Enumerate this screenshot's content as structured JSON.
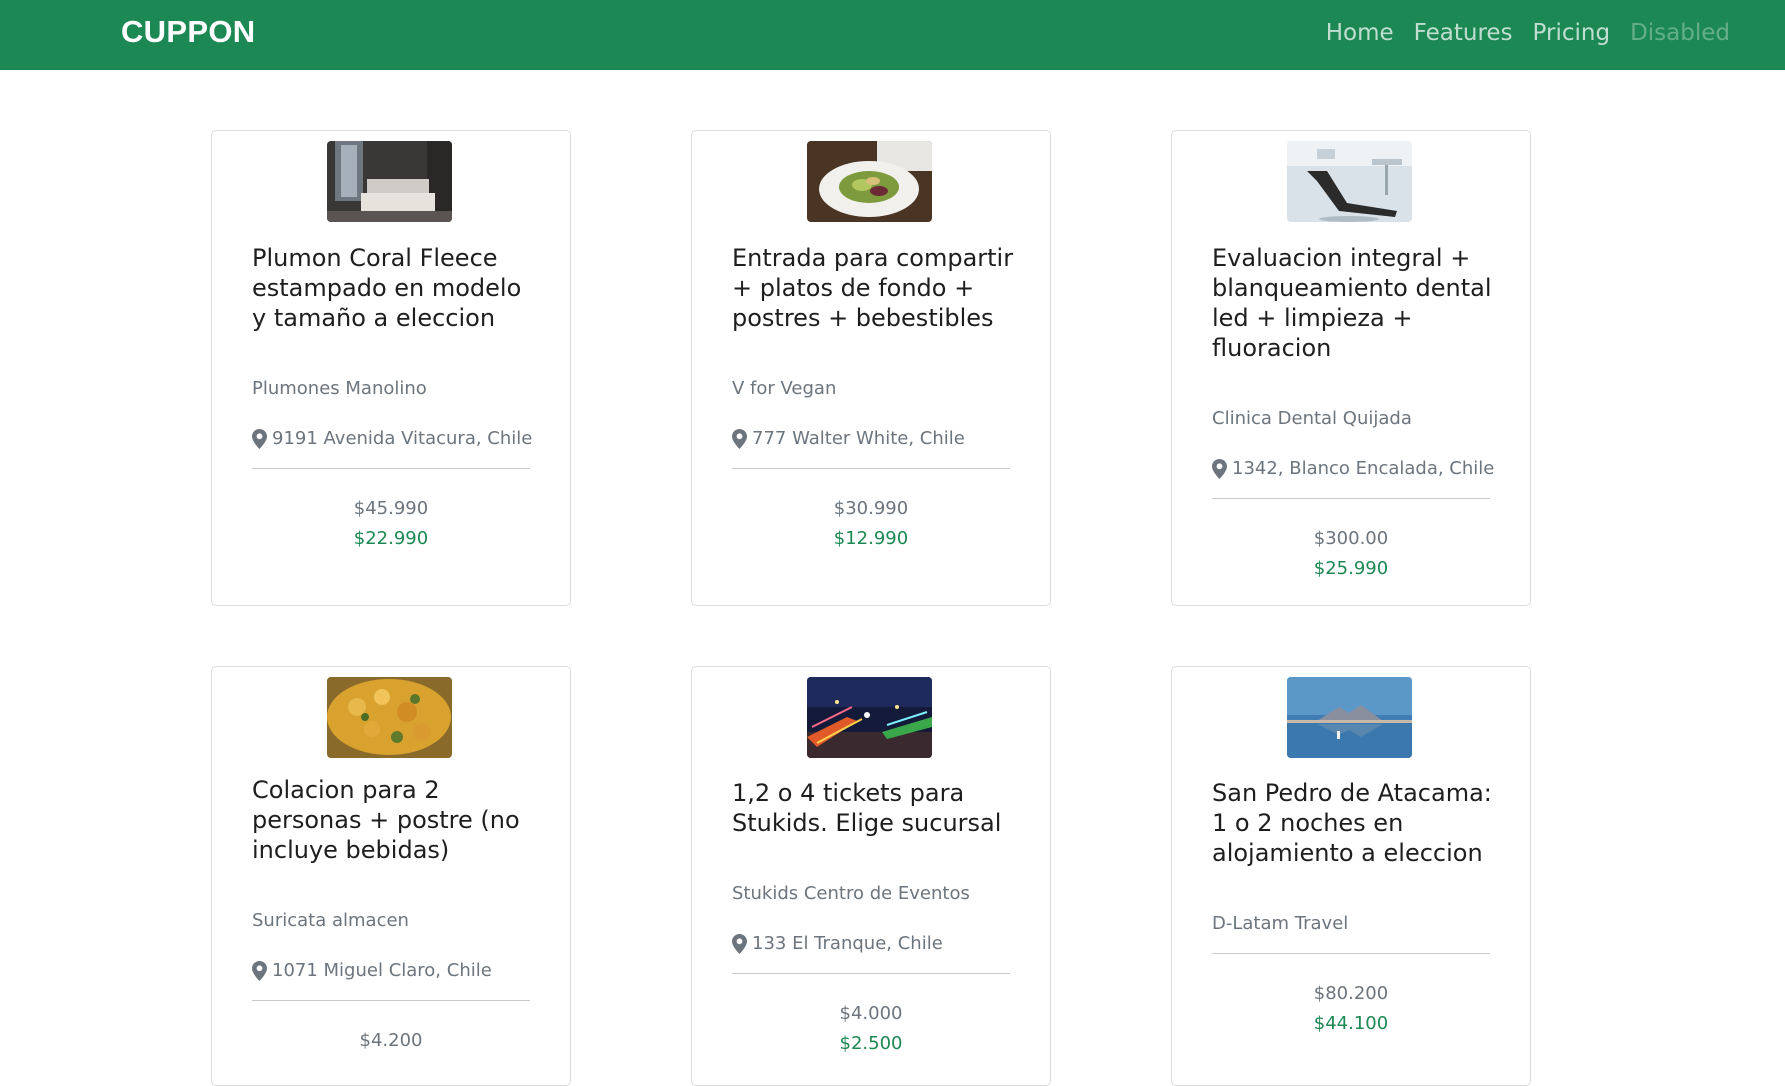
{
  "navbar": {
    "brand": "CUPPON",
    "links": [
      "Home",
      "Features",
      "Pricing",
      "Disabled"
    ]
  },
  "colors": {
    "brand_green": "#1c8853",
    "muted_text": "#6c757d",
    "title_text": "#1e1e1e"
  },
  "cards": [
    {
      "title": "Plumon Coral Fleece estampado en modelo y tamaño a eleccion",
      "vendor": "Plumones Manolino",
      "address": "9191 Avenida Vitacura, Chile",
      "old_price": "$45.990",
      "new_price": "$22.990",
      "image": "bedroom-photo"
    },
    {
      "title": "Entrada para compartir + platos de fondo + postres + bebestibles",
      "vendor": "V for Vegan",
      "address": "777 Walter White, Chile",
      "old_price": "$30.990",
      "new_price": "$12.990",
      "image": "salad-plate-photo"
    },
    {
      "title": "Evaluacion integral + blanqueamiento dental led + limpieza + fluoracion",
      "vendor": "Clinica Dental Quijada",
      "address": "1342, Blanco Encalada, Chile",
      "old_price": "$300.00",
      "new_price": "$25.990",
      "image": "dental-chair-photo"
    },
    {
      "title": "Colacion para 2 personas + postre (no incluye bebidas)",
      "vendor": "Suricata almacen",
      "address": "1071 Miguel Claro, Chile",
      "old_price": "$4.200",
      "new_price": "",
      "image": "food-dish-photo"
    },
    {
      "title": "1,2 o 4 tickets para Stukids. Elige sucursal",
      "vendor": "Stukids Centro de Eventos",
      "address": "133 El Tranque, Chile",
      "old_price": "$4.000",
      "new_price": "$2.500",
      "image": "fairground-night-photo"
    },
    {
      "title": "San Pedro de Atacama: 1 o 2 noches en alojamiento a eleccion",
      "vendor": "D-Latam Travel",
      "address": "",
      "old_price": "$80.200",
      "new_price": "$44.100",
      "image": "salt-lagoon-photo"
    }
  ]
}
